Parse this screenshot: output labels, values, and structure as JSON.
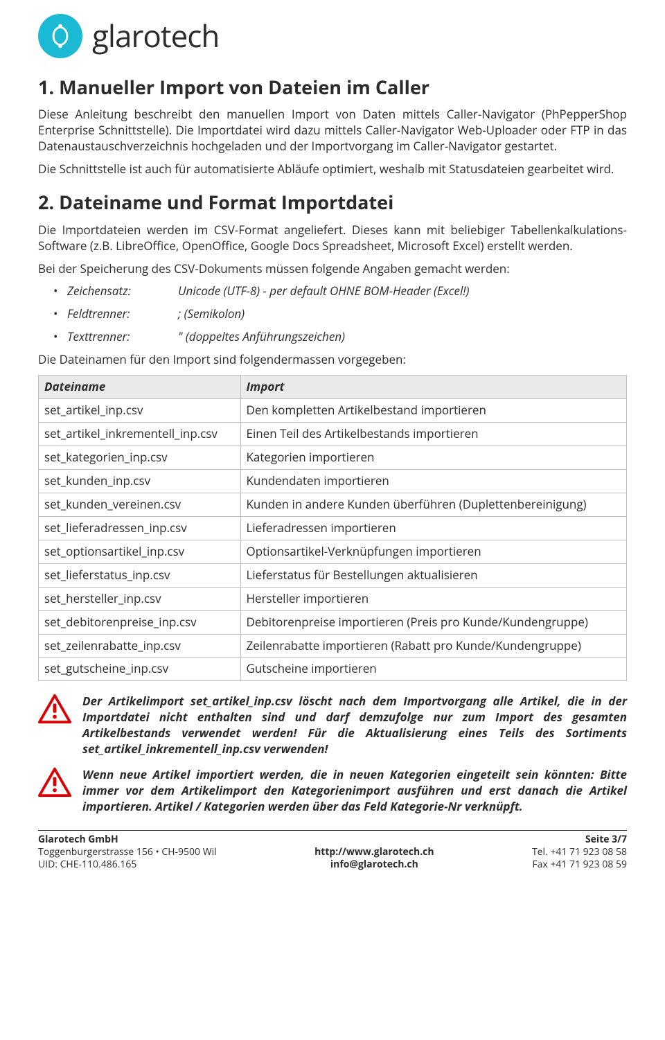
{
  "brand": {
    "name": "glarotech"
  },
  "h1": "1. Manueller Import von Dateien im Caller",
  "p1": "Diese Anleitung beschreibt den manuellen Import von Daten mittels Caller-Navigator (PhPepperShop Enterprise Schnittstelle). Die Importdatei wird dazu mittels Caller-Navigator Web-Uploader oder FTP in das Datenaustauschverzeichnis hochgeladen und der Importvorgang im Caller-Navigator gestartet.",
  "p2": "Die Schnittstelle ist auch für automatisierte Abläufe optimiert, weshalb mit Statusdateien gearbeitet wird.",
  "h2": "2. Dateiname und Format Importdatei",
  "p3": "Die Importdateien werden im CSV-Format angeliefert. Dieses kann mit beliebiger Tabellenkalkulations-Software (z.B. LibreOffice, OpenOffice, Google Docs Spreadsheet, Microsoft Excel) erstellt werden.",
  "p4": "Bei der Speicherung des CSV-Dokuments müssen folgende Angaben gemacht werden:",
  "csvSettings": [
    {
      "k": "Zeichensatz:",
      "v": "Unicode (UTF-8) - per default OHNE BOM-Header (Excel!)"
    },
    {
      "k": "Feldtrenner:",
      "v": ";   (Semikolon)"
    },
    {
      "k": "Texttrenner:",
      "v": "\"   (doppeltes Anführungszeichen)"
    }
  ],
  "p5": "Die Dateinamen für den Import sind folgendermassen vorgegeben:",
  "table": {
    "head": {
      "c1": "Dateiname",
      "c2": "Import"
    },
    "rows": [
      {
        "c1": "set_artikel_inp.csv",
        "c2": "Den kompletten Artikelbestand importieren"
      },
      {
        "c1": "set_artikel_inkrementell_inp.csv",
        "c2": "Einen Teil des Artikelbestands importieren"
      },
      {
        "c1": "set_kategorien_inp.csv",
        "c2": "Kategorien importieren"
      },
      {
        "c1": "set_kunden_inp.csv",
        "c2": "Kundendaten importieren"
      },
      {
        "c1": "set_kunden_vereinen.csv",
        "c2": "Kunden in andere Kunden überführen (Duplettenbereinigung)"
      },
      {
        "c1": "set_lieferadressen_inp.csv",
        "c2": "Lieferadressen importieren"
      },
      {
        "c1": "set_optionsartikel_inp.csv",
        "c2": "Optionsartikel-Verknüpfungen importieren"
      },
      {
        "c1": "set_lieferstatus_inp.csv",
        "c2": "Lieferstatus für Bestellungen aktualisieren"
      },
      {
        "c1": "set_hersteller_inp.csv",
        "c2": "Hersteller importieren"
      },
      {
        "c1": "set_debitorenpreise_inp.csv",
        "c2": "Debitorenpreise importieren (Preis pro Kunde/Kundengruppe)"
      },
      {
        "c1": "set_zeilenrabatte_inp.csv",
        "c2": "Zeilenrabatte importieren (Rabatt pro Kunde/Kundengruppe)"
      },
      {
        "c1": "set_gutscheine_inp.csv",
        "c2": "Gutscheine importieren"
      }
    ]
  },
  "warn1": "Der Artikelimport set_artikel_inp.csv löscht nach dem Importvorgang alle Artikel, die in der Importdatei nicht enthalten sind und darf demzufolge nur zum Import des gesamten Artikelbestands verwendet werden! Für die Aktualisierung eines Teils des Sortiments set_artikel_inkrementell_inp.csv verwenden!",
  "warn2": "Wenn neue Artikel importiert werden, die in neuen Kategorien eingeteilt sein könnten: Bitte immer vor dem Artikelimport den Kategorienimport ausführen und erst danach die Artikel importieren. Artikel / Kategorien werden über das Feld Kategorie-Nr verknüpft.",
  "footer": {
    "left": {
      "l1": "Glarotech GmbH",
      "l2": "Toggenburgerstrasse 156 • CH-9500 Wil",
      "l3": "UID: CHE-110.486.165"
    },
    "center": {
      "l1": "http://www.glarotech.ch",
      "l2": "info@glarotech.ch"
    },
    "right": {
      "l1": "Seite 3/7",
      "l2": "Tel. +41 71 923 08 58",
      "l3": "Fax +41 71 923 08 59"
    }
  }
}
